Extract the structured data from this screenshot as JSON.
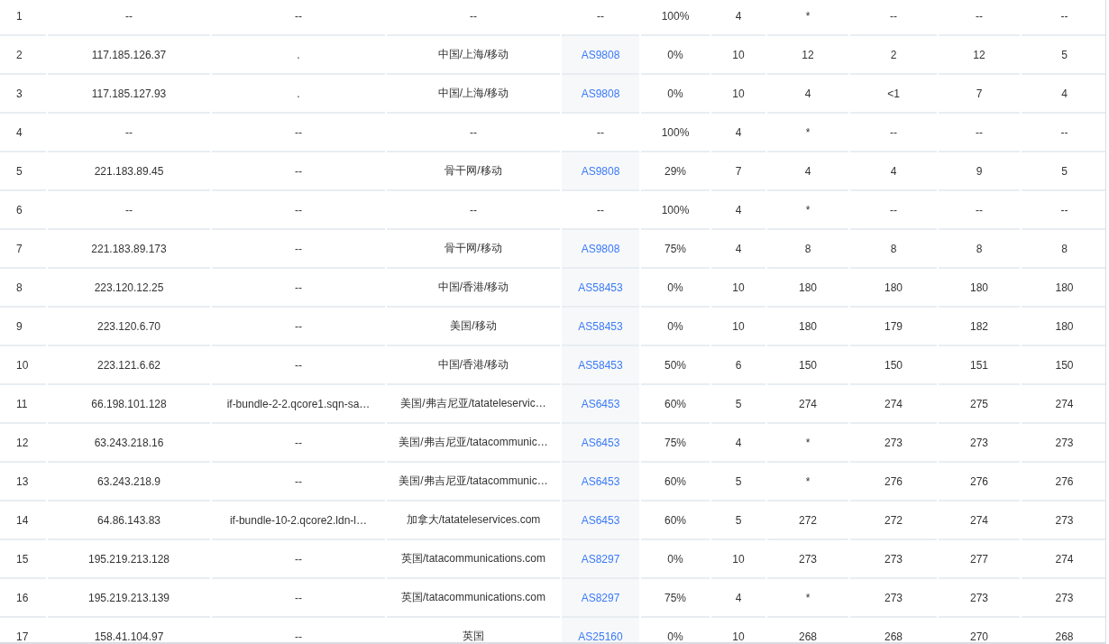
{
  "table": {
    "rows": [
      {
        "column_1": "1",
        "column_2": "--",
        "column_3": "--",
        "column_4": "--",
        "column_5": {
          "kind": "text",
          "text": "--"
        },
        "column_6": "100%",
        "column_7": "4",
        "column_8": "*",
        "column_9": "--",
        "column_10": "--",
        "column_11": "--"
      },
      {
        "column_1": "2",
        "column_2": "117.185.126.37",
        "column_3": ".",
        "column_4": "中国/上海/移动",
        "column_5": {
          "kind": "link",
          "text": "AS9808"
        },
        "column_6": "0%",
        "column_7": "10",
        "column_8": "12",
        "column_9": "2",
        "column_10": "12",
        "column_11": "5"
      },
      {
        "column_1": "3",
        "column_2": "117.185.127.93",
        "column_3": ".",
        "column_4": "中国/上海/移动",
        "column_5": {
          "kind": "link",
          "text": "AS9808"
        },
        "column_6": "0%",
        "column_7": "10",
        "column_8": "4",
        "column_9": "<1",
        "column_10": "7",
        "column_11": "4"
      },
      {
        "column_1": "4",
        "column_2": "--",
        "column_3": "--",
        "column_4": "--",
        "column_5": {
          "kind": "text",
          "text": "--"
        },
        "column_6": "100%",
        "column_7": "4",
        "column_8": "*",
        "column_9": "--",
        "column_10": "--",
        "column_11": "--"
      },
      {
        "column_1": "5",
        "column_2": "221.183.89.45",
        "column_3": "--",
        "column_4": "骨干网/移动",
        "column_5": {
          "kind": "link",
          "text": "AS9808"
        },
        "column_6": "29%",
        "column_7": "7",
        "column_8": "4",
        "column_9": "4",
        "column_10": "9",
        "column_11": "5"
      },
      {
        "column_1": "6",
        "column_2": "--",
        "column_3": "--",
        "column_4": "--",
        "column_5": {
          "kind": "text",
          "text": "--"
        },
        "column_6": "100%",
        "column_7": "4",
        "column_8": "*",
        "column_9": "--",
        "column_10": "--",
        "column_11": "--"
      },
      {
        "column_1": "7",
        "column_2": "221.183.89.173",
        "column_3": "--",
        "column_4": "骨干网/移动",
        "column_5": {
          "kind": "link",
          "text": "AS9808"
        },
        "column_6": "75%",
        "column_7": "4",
        "column_8": "8",
        "column_9": "8",
        "column_10": "8",
        "column_11": "8"
      },
      {
        "column_1": "8",
        "column_2": "223.120.12.25",
        "column_3": "--",
        "column_4": "中国/香港/移动",
        "column_5": {
          "kind": "link",
          "text": "AS58453"
        },
        "column_6": "0%",
        "column_7": "10",
        "column_8": "180",
        "column_9": "180",
        "column_10": "180",
        "column_11": "180"
      },
      {
        "column_1": "9",
        "column_2": "223.120.6.70",
        "column_3": "--",
        "column_4": "美国/移动",
        "column_5": {
          "kind": "link",
          "text": "AS58453"
        },
        "column_6": "0%",
        "column_7": "10",
        "column_8": "180",
        "column_9": "179",
        "column_10": "182",
        "column_11": "180"
      },
      {
        "column_1": "10",
        "column_2": "223.121.6.62",
        "column_3": "--",
        "column_4": "中国/香港/移动",
        "column_5": {
          "kind": "link",
          "text": "AS58453"
        },
        "column_6": "50%",
        "column_7": "6",
        "column_8": "150",
        "column_9": "150",
        "column_10": "151",
        "column_11": "150"
      },
      {
        "column_1": "11",
        "column_2": "66.198.101.128",
        "column_3": "if-bundle-2-2.qcore1.sqn-sa…",
        "column_4": "美国/弗吉尼亚/tatateleservic…",
        "column_5": {
          "kind": "link",
          "text": "AS6453"
        },
        "column_6": "60%",
        "column_7": "5",
        "column_8": "274",
        "column_9": "274",
        "column_10": "275",
        "column_11": "274"
      },
      {
        "column_1": "12",
        "column_2": "63.243.218.16",
        "column_3": "--",
        "column_4": "美国/弗吉尼亚/tatacommunic…",
        "column_5": {
          "kind": "link",
          "text": "AS6453"
        },
        "column_6": "75%",
        "column_7": "4",
        "column_8": "*",
        "column_9": "273",
        "column_10": "273",
        "column_11": "273"
      },
      {
        "column_1": "13",
        "column_2": "63.243.218.9",
        "column_3": "--",
        "column_4": "美国/弗吉尼亚/tatacommunic…",
        "column_5": {
          "kind": "link",
          "text": "AS6453"
        },
        "column_6": "60%",
        "column_7": "5",
        "column_8": "*",
        "column_9": "276",
        "column_10": "276",
        "column_11": "276"
      },
      {
        "column_1": "14",
        "column_2": "64.86.143.83",
        "column_3": "if-bundle-10-2.qcore2.ldn-l…",
        "column_4": "加拿大/tatateleservices.com",
        "column_5": {
          "kind": "link",
          "text": "AS6453"
        },
        "column_6": "60%",
        "column_7": "5",
        "column_8": "272",
        "column_9": "272",
        "column_10": "274",
        "column_11": "273"
      },
      {
        "column_1": "15",
        "column_2": "195.219.213.128",
        "column_3": "--",
        "column_4": "英国/tatacommunications.com",
        "column_5": {
          "kind": "link",
          "text": "AS8297"
        },
        "column_6": "0%",
        "column_7": "10",
        "column_8": "273",
        "column_9": "273",
        "column_10": "277",
        "column_11": "274"
      },
      {
        "column_1": "16",
        "column_2": "195.219.213.139",
        "column_3": "--",
        "column_4": "英国/tatacommunications.com",
        "column_5": {
          "kind": "link",
          "text": "AS8297"
        },
        "column_6": "75%",
        "column_7": "4",
        "column_8": "*",
        "column_9": "273",
        "column_10": "273",
        "column_11": "273"
      },
      {
        "column_1": "17",
        "column_2": "158.41.104.97",
        "column_3": "--",
        "column_4": "英国",
        "column_5": {
          "kind": "link",
          "text": "AS25160"
        },
        "column_6": "0%",
        "column_7": "10",
        "column_8": "268",
        "column_9": "268",
        "column_10": "270",
        "column_11": "268"
      }
    ]
  }
}
